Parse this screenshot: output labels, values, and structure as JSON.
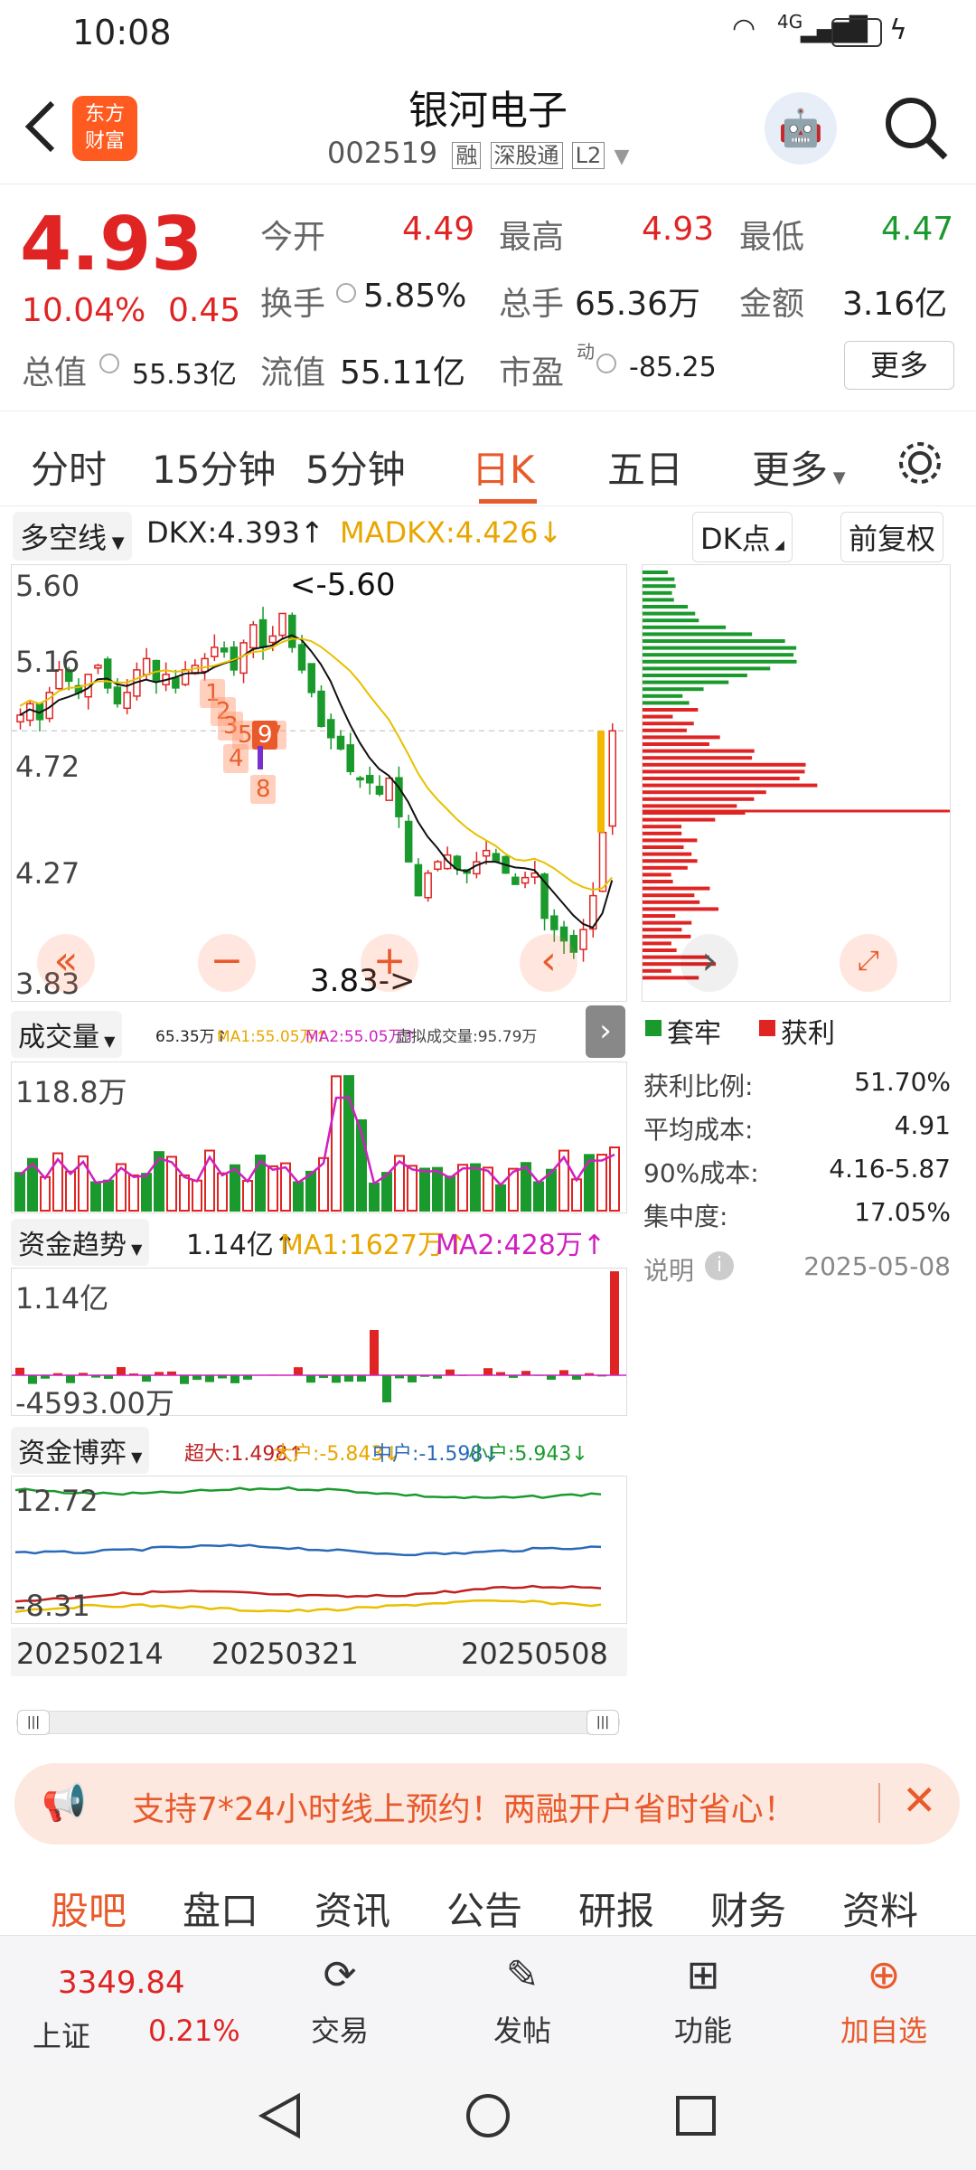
{
  "status": {
    "time": "10:08",
    "net": "4G",
    "battery": "35"
  },
  "header": {
    "title": "银河电子",
    "code": "002519",
    "tags": [
      "融",
      "深股通",
      "L2"
    ],
    "logo_line1": "东方",
    "logo_line2": "财富"
  },
  "quote": {
    "price": "4.93",
    "pct": "10.04%",
    "chg": "0.45",
    "open_label": "今开",
    "open": "4.49",
    "high_label": "最高",
    "high": "4.93",
    "low_label": "最低",
    "low": "4.47",
    "turnover_label": "换手",
    "turnover": "5.85%",
    "vol_label": "总手",
    "vol": "65.36万",
    "amt_label": "金额",
    "amt": "3.16亿",
    "mcap_label": "总值",
    "mcap": "55.53亿",
    "float_label": "流值",
    "float": "55.11亿",
    "pe_label": "市盈",
    "pe_sup": "动",
    "pe": "-85.25",
    "more": "更多"
  },
  "tabs": [
    "分时",
    "15分钟",
    "5分钟",
    "日K",
    "五日"
  ],
  "tab_more": "更多",
  "kline": {
    "indicator": "多空线",
    "dkx": "DKX:4.393↑",
    "madkx": "MADKX:4.426↓",
    "dkpoint": "DK点",
    "adjust": "前复权",
    "y_labels": [
      "5.60",
      "5.16",
      "4.72",
      "4.27",
      "3.83"
    ],
    "high_mark": "<-5.60",
    "low_mark": "3.83->",
    "markers": [
      "1",
      "2",
      "3",
      "4",
      "567",
      "8",
      "9"
    ]
  },
  "chips": {
    "trapped": "套牢",
    "profit": "获利",
    "rows": [
      {
        "k": "获利比例:",
        "v": "51.70%"
      },
      {
        "k": "平均成本:",
        "v": "4.91"
      },
      {
        "k": "90%成本:",
        "v": "4.16-5.87"
      },
      {
        "k": "集中度:",
        "v": "17.05%"
      }
    ],
    "note": "说明",
    "date": "2025-05-08"
  },
  "volume": {
    "label": "成交量",
    "v": "65.35万↑",
    "ma1": "MA1:55.05万↑",
    "ma2": "MA2:55.05万↑",
    "virtual": "虚拟成交量:95.79万",
    "ytop": "118.8万"
  },
  "fund": {
    "label": "资金趋势",
    "v": "1.14亿↑",
    "ma1": "MA1:1627万↑",
    "ma2": "MA2:428万↑",
    "ytop": "1.14亿",
    "ybot": "-4593.00万"
  },
  "game": {
    "label": "资金博弈",
    "super": "超大:1.498↑",
    "large": "大户:-5.843↓",
    "mid": "中户:-1.598↓",
    "small": "小户:5.943↓",
    "ytop": "12.72",
    "ybot": "-8.31"
  },
  "dates": [
    "20250214",
    "20250321",
    "20250508"
  ],
  "banner": {
    "text": "支持7*24小时线上预约！两融开户省时省心！"
  },
  "bottom_tabs": [
    "股吧",
    "盘口",
    "资讯",
    "公告",
    "研报",
    "财务",
    "资料"
  ],
  "nav": {
    "index_value": "3349.84",
    "index_name": "上证",
    "index_pct": "0.21%",
    "items": [
      "交易",
      "发帖",
      "功能",
      "加自选"
    ]
  },
  "colors": {
    "up": "#e02424",
    "down": "#1a9a2c",
    "accent": "#ff6a2c"
  }
}
